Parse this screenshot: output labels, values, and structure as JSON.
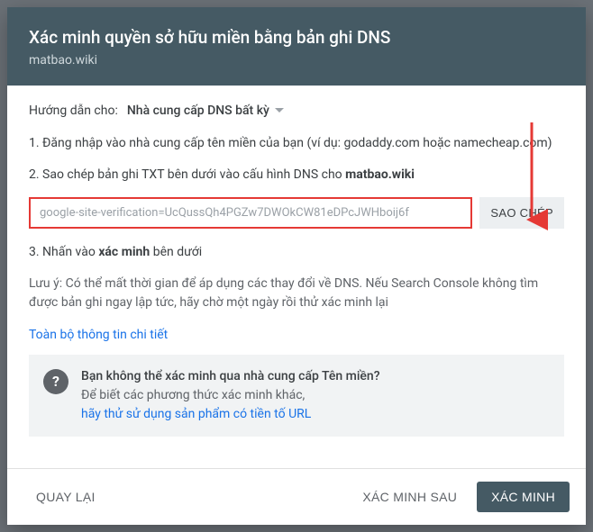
{
  "header": {
    "title": "Xác minh quyền sở hữu miền bằng bản ghi DNS",
    "subtitle": "matbao.wiki"
  },
  "provider": {
    "label": "Hướng dẫn cho:",
    "selected": "Nhà cung cấp DNS bất kỳ"
  },
  "steps": {
    "s1": "1. Đăng nhập vào nhà cung cấp tên miền của bạn (ví dụ: godaddy.com hoặc namecheap.com)",
    "s2_prefix": "2. Sao chép bản ghi TXT bên dưới vào cấu hình DNS cho ",
    "s2_domain": "matbao.wiki",
    "s3_prefix": "3. Nhấn vào ",
    "s3_bold": "xác minh",
    "s3_suffix": " bên dưới"
  },
  "record": {
    "value": "google-site-verification=UcQussQh4PGZw7DWOkCW81eDPcJWHboij6f",
    "copy_label": "SAO CHÉP"
  },
  "note": "Lưu ý: Có thể mất thời gian để áp dụng các thay đổi về DNS. Nếu Search Console không tìm được bản ghi ngay lập tức, hãy chờ một ngày rồi thử xác minh lại",
  "details_link": "Toàn bộ thông tin chi tiết",
  "info_box": {
    "title": "Bạn không thể xác minh qua nhà cung cấp Tên miền?",
    "sub": "Để biết các phương thức xác minh khác,",
    "link": "hãy thử sử dụng sản phẩm có tiền tố URL"
  },
  "footer": {
    "back": "QUAY LẠI",
    "later": "XÁC MINH SAU",
    "verify": "XÁC MINH"
  },
  "annotation": {
    "color": "#e53935"
  }
}
